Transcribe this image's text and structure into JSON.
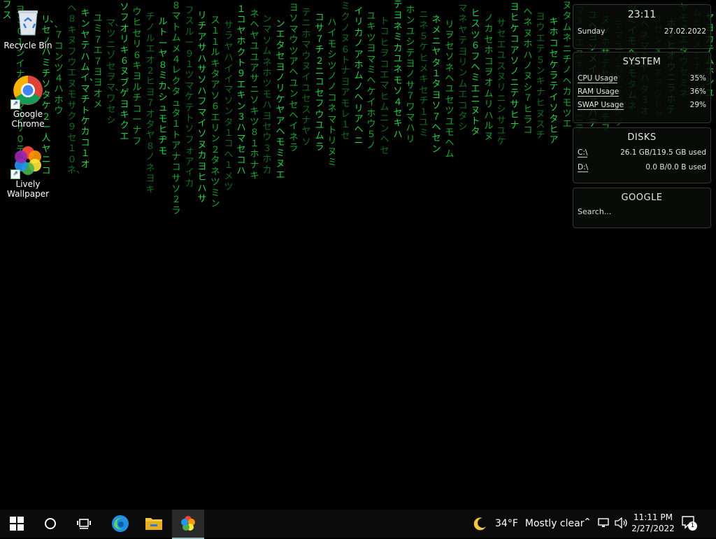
{
  "desktop": {
    "icons": [
      {
        "label": "Recycle Bin"
      },
      {
        "label": "Google\nChrome"
      },
      {
        "label": "Lively\nWallpaper"
      }
    ]
  },
  "widgets": {
    "clock": {
      "time": "23:11",
      "day": "Sunday",
      "date": "27.02.2022"
    },
    "system": {
      "title": "SYSTEM",
      "rows": [
        {
          "label": "CPU Usage",
          "value": "35%",
          "percent": 35
        },
        {
          "label": "RAM Usage",
          "value": "36%",
          "percent": 36
        },
        {
          "label": "SWAP Usage",
          "value": "29%",
          "percent": 29
        }
      ]
    },
    "disks": {
      "title": "DISKS",
      "rows": [
        {
          "label": "C:\\",
          "value": "26.1 GB/119.5 GB used"
        },
        {
          "label": "D:\\",
          "value": "0.0 B/0.0 B used"
        }
      ]
    },
    "google": {
      "title": "GOOGLE",
      "placeholder": "Search..."
    }
  },
  "taskbar": {
    "weather": {
      "temp": "34°F",
      "condition": "Mostly clear"
    },
    "time": "11:11 PM",
    "date": "2/27/2022",
    "notification_count": "1"
  },
  "matrix_rain": {
    "color": "#0fae2e",
    "columns": [
      {
        "chars": "フス"
      },
      {
        "chars": "ヨ３０１ンイナ６チマラサ０テ"
      },
      {
        "chars": "１セ"
      },
      {
        "chars": "リ、セノハミチソタケ２ー人ヤニコ"
      },
      {
        "chars": "、７コンツ４ハホウ"
      },
      {
        "chars": "ヘ８キヌフウエヌモサク９セ１０ネ、"
      },
      {
        "chars": "キンヤテハムイ、マチトケカコ１オ"
      },
      {
        "chars": "ユミ７エ７ヨヨオメ"
      },
      {
        "chars": "マ、ツニゾセヲマ、ワセシ"
      },
      {
        "chars": "ソフオリキ６ヌブゲヨキクエ"
      },
      {
        "chars": "ウヒセリ６キヨルチコーナフ"
      },
      {
        "chars": "チノルエオ２ヒヨ７オタヤ８ノネヨキ"
      },
      {
        "chars": "ルトーヤ８ミカ、シュモヒヂモ"
      },
      {
        "chars": "８マトムメ４レクタュタ１トアナコサソ２ラ"
      },
      {
        "chars": "フスルー９１ツマケテトソフォアイカ"
      },
      {
        "chars": "リチアサハサソハフマイソヌカヨヒハサ"
      },
      {
        "chars": "ス１１ルキタアソ６エリン２タネツミン"
      },
      {
        "chars": "サラヤハイイマソンタ１コヘ１メツ"
      },
      {
        "chars": "１コヤホクト９エキン３ハマセコハ"
      },
      {
        "chars": "ネヘヤユユアサニソキツ８１ホナキ"
      },
      {
        "chars": "ンマソムネホツモハヨセウ３ホカ"
      },
      {
        "chars": "ンエタセヨノリケヤアヘモミヌエ"
      },
      {
        "chars": "ヨソマウツアヘユンセヘイネラ"
      },
      {
        "chars": "テニホマウヌイユセスナヤソ"
      },
      {
        "chars": "コサ７チ２ニコセフウユムラ"
      },
      {
        "chars": "ハイモシツノノコネマトリヌミ"
      },
      {
        "chars": "ミクノヌ６トナヨアモレ１セ"
      },
      {
        "chars": "イリカノアホムノヘリアヘニ"
      },
      {
        "chars": "ユキツヨマミヘケイホウ５ノ"
      },
      {
        "chars": "トコヒヲコエマヒムニンヘセ"
      },
      {
        "chars": "テヨネミカユネモソ４セキハ"
      },
      {
        "chars": "ホンユシテヨノサ７ワマハリ"
      },
      {
        "chars": "ニネ５ケヒメキセチ１ユミ"
      },
      {
        "chars": "ネメニヤタ１タヨソ７ヘセン"
      },
      {
        "chars": "リヲセソネヘユセツユモヘム"
      },
      {
        "chars": "マネヤテヨリンムエコタシ"
      },
      {
        "chars": "ヒスツ６フヘミエニヌトタ"
      },
      {
        "chars": "ノカセホコヲオムリハルヌ"
      },
      {
        "chars": "サセエユスヌリニシサユケ"
      },
      {
        "chars": "ヨヒケコアソノニテサヒナ"
      },
      {
        "chars": "ヘネヌホハノヌシ７ヒラコ"
      },
      {
        "chars": "ヨウエテ５ンキナヒヌスチ"
      },
      {
        "chars": "キホコセケラテイソタヒア"
      },
      {
        "chars": "ヌタムネニチノヘカモツエ"
      },
      {
        "chars": "マヌタエユナホツカラニテ"
      },
      {
        "chars": "ユヘヨソメイノソアハテ"
      },
      {
        "chars": "ヌソホサテヒセエノチフ"
      },
      {
        "chars": "テマユノカホエセタソ"
      },
      {
        "chars": "ツミイモヘカモタムネ"
      },
      {
        "chars": "ニヘネマミヤハタ３オ"
      },
      {
        "chars": "ユセンメリネアシトア"
      },
      {
        "chars": "ホケヒオウニラホテ"
      },
      {
        "chars": "ヤモヌエタウセミネ"
      },
      {
        "chars": "ムヒクメエナスイア"
      },
      {
        "chars": "ヤヨカテムホシユ"
      }
    ]
  }
}
